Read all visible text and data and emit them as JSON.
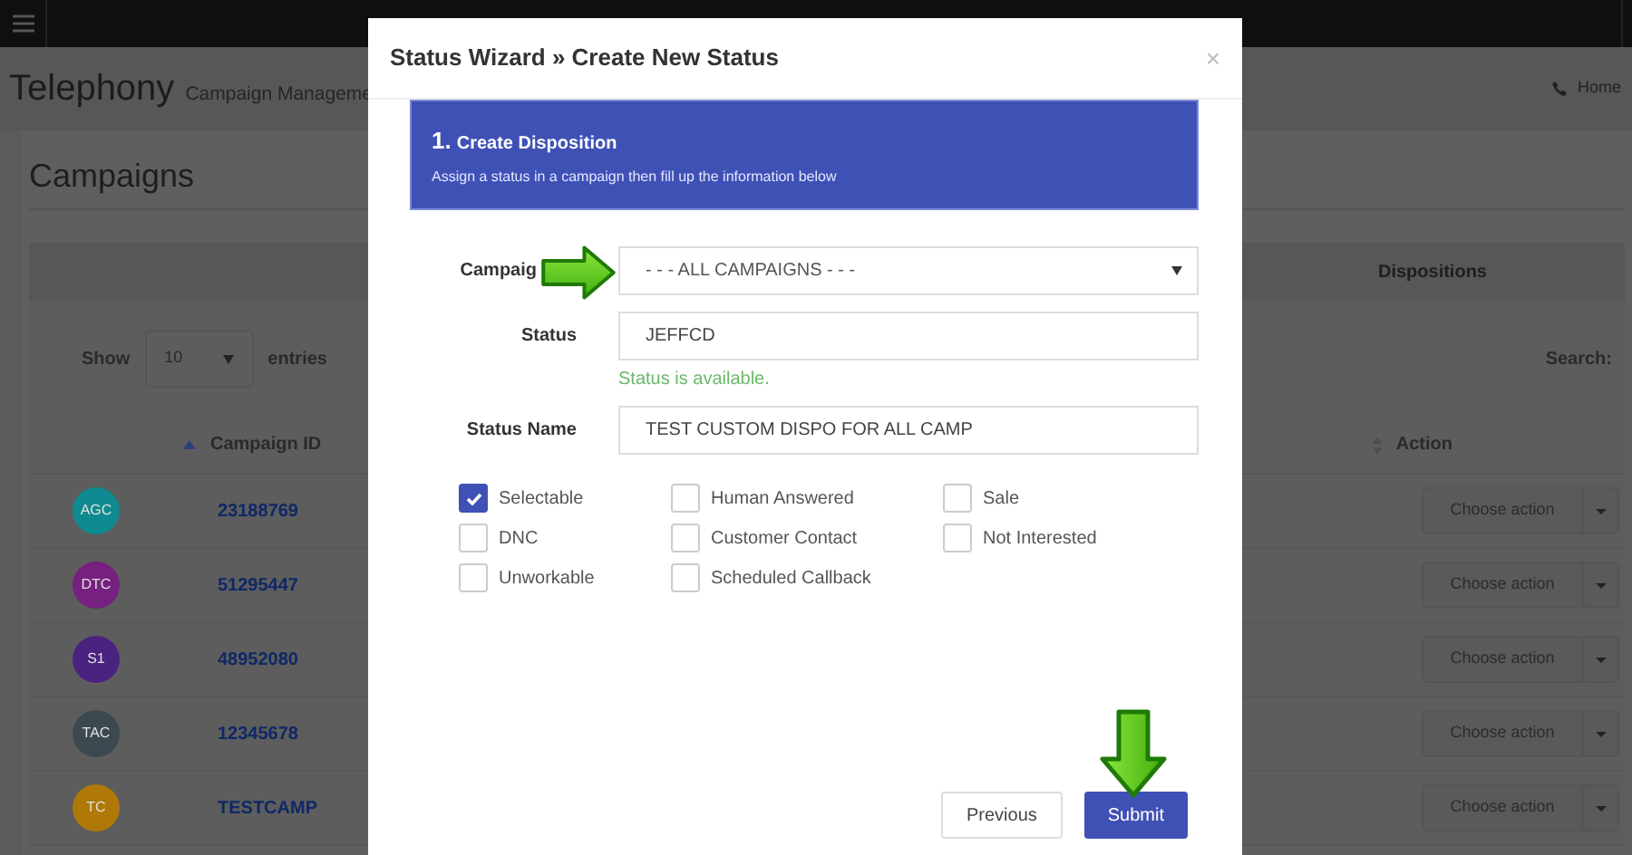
{
  "header": {
    "title": "Telephony",
    "subtitle": "Campaign Manageme",
    "breadcrumb": "Home"
  },
  "panel": {
    "title": "Campaigns",
    "tab_header": "Dispositions",
    "show_label": "Show",
    "page_size": "10",
    "entries_label": "entries",
    "search_label": "Search:",
    "columns": [
      "Campaign ID",
      "Action"
    ],
    "rows": [
      {
        "avatar": "AGC",
        "color": "#0e8a90",
        "campaign_id": "23188769",
        "action": "Choose action"
      },
      {
        "avatar": "DTC",
        "color": "#76207f",
        "campaign_id": "51295447",
        "action": "Choose action"
      },
      {
        "avatar": "S1",
        "color": "#4a2380",
        "campaign_id": "48952080",
        "action": "Choose action"
      },
      {
        "avatar": "TAC",
        "color": "#3b4950",
        "campaign_id": "12345678",
        "action": "Choose action"
      },
      {
        "avatar": "TC",
        "color": "#b07806",
        "campaign_id": "TESTCAMP",
        "action": "Choose action"
      }
    ]
  },
  "modal": {
    "title": "Status Wizard » Create New Status",
    "close": "×",
    "step": {
      "number": "1.",
      "title": "Create Disposition",
      "description": "Assign a status in a campaign then fill up the information below"
    },
    "fields": [
      {
        "kind": "select",
        "label": "Campaig",
        "value": "- - - ALL CAMPAIGNS - - -"
      },
      {
        "kind": "text",
        "label": "Status",
        "value": "JEFFCD",
        "hint": "Status is available."
      },
      {
        "kind": "text",
        "label": "Status Name",
        "value": "TEST CUSTOM DISPO FOR ALL CAMP"
      }
    ],
    "checkboxes": [
      {
        "label": "Selectable",
        "checked": true
      },
      {
        "label": "Human Answered",
        "checked": false
      },
      {
        "label": "Sale",
        "checked": false
      },
      {
        "label": "DNC",
        "checked": false
      },
      {
        "label": "Customer Contact",
        "checked": false
      },
      {
        "label": "Not Interested",
        "checked": false
      },
      {
        "label": "Unworkable",
        "checked": false
      },
      {
        "label": "Scheduled Callback",
        "checked": false
      }
    ],
    "buttons": [
      {
        "label": "Previous",
        "kind": "secondary"
      },
      {
        "label": "Submit",
        "kind": "primary"
      }
    ]
  }
}
